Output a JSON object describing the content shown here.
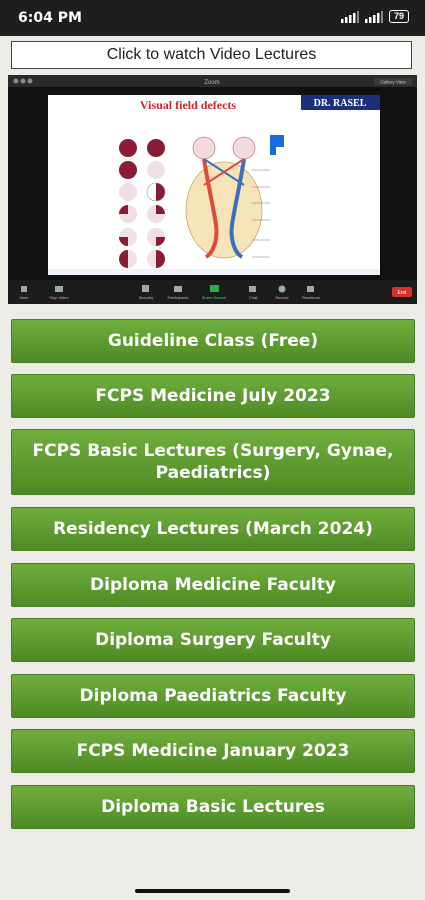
{
  "status": {
    "time": "6:04 PM",
    "battery": "79"
  },
  "watch_button_label": "Click to watch Video Lectures",
  "video": {
    "window_title": "Zoom",
    "gallery_view": "Gallery View",
    "slide_title": "Visual field defects",
    "presenter": "DR. RASEL",
    "toolbar": [
      "Mute",
      "Stop Video",
      "Security",
      "Participants",
      "Share Screen",
      "Chat",
      "Record",
      "Reactions"
    ],
    "end_label": "End"
  },
  "menu": [
    "Guideline Class (Free)",
    "FCPS Medicine July 2023",
    "FCPS Basic Lectures (Surgery, Gynae, Paediatrics)",
    "Residency Lectures (March 2024)",
    "Diploma Medicine Faculty",
    "Diploma Surgery Faculty",
    "Diploma Paediatrics Faculty",
    "FCPS Medicine January 2023",
    "Diploma Basic Lectures"
  ],
  "colors": {
    "button": "#5b9a2f",
    "slide_title": "#d4262c",
    "presenter_bg": "#1c2f7a"
  }
}
